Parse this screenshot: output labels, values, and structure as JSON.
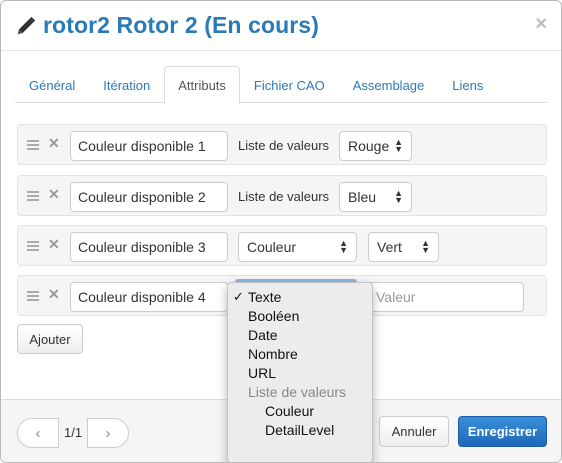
{
  "header": {
    "title": "rotor2 Rotor 2 (En cours)",
    "close_glyph": "×"
  },
  "tabs": [
    {
      "label": "Général"
    },
    {
      "label": "Itération"
    },
    {
      "label": "Attributs"
    },
    {
      "label": "Fichier CAO"
    },
    {
      "label": "Assemblage"
    },
    {
      "label": "Liens"
    }
  ],
  "attributes": [
    {
      "name": "Couleur disponible 1",
      "type_label": "Liste de valeurs",
      "value": "Rouge"
    },
    {
      "name": "Couleur disponible 2",
      "type_label": "Liste de valeurs",
      "value": "Bleu"
    },
    {
      "name": "Couleur disponible 3",
      "type": "Couleur",
      "value": "Vert"
    },
    {
      "name": "Couleur disponible 4",
      "value_placeholder": "Valeur"
    }
  ],
  "add_button": "Ajouter",
  "dropdown": {
    "check": "✓",
    "items": [
      "Texte",
      "Booléen",
      "Date",
      "Nombre",
      "URL"
    ],
    "group_label": "Liste de valeurs",
    "group_items": [
      "Couleur",
      "DetailLevel"
    ]
  },
  "pagination": {
    "prev": "‹",
    "label": "1/1",
    "next": "›"
  },
  "footer": {
    "cancel": "Annuler",
    "save": "Enregistrer"
  },
  "colors": {
    "accent": "#2a7ab7",
    "primary_button": "#1e68b8"
  }
}
